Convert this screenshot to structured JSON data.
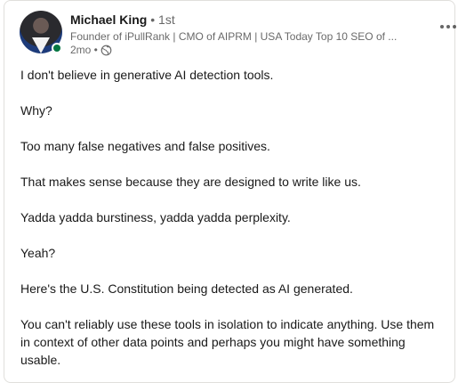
{
  "post": {
    "author": {
      "name": "Michael King",
      "degree": "• 1st",
      "headline": "Founder of iPullRank | CMO of AIPRM | USA Today Top 10 SEO of ...",
      "time": "2mo •",
      "visibility_icon": "globe-icon"
    },
    "paragraphs": [
      "I don't believe in generative AI detection tools.",
      "Why?",
      "Too many false negatives and false positives.",
      "That makes sense because they are designed to write like us.",
      "Yadda yadda burstiness, yadda yadda perplexity.",
      "Yeah?",
      "Here's the U.S. Constitution being detected as AI generated.",
      "You can't reliably use these tools in isolation to indicate anything. Use them in context of other data points and perhaps you might have something usable."
    ]
  },
  "colors": {
    "online": "#057642",
    "border": "#e0dfdc",
    "muted": "#666666"
  }
}
